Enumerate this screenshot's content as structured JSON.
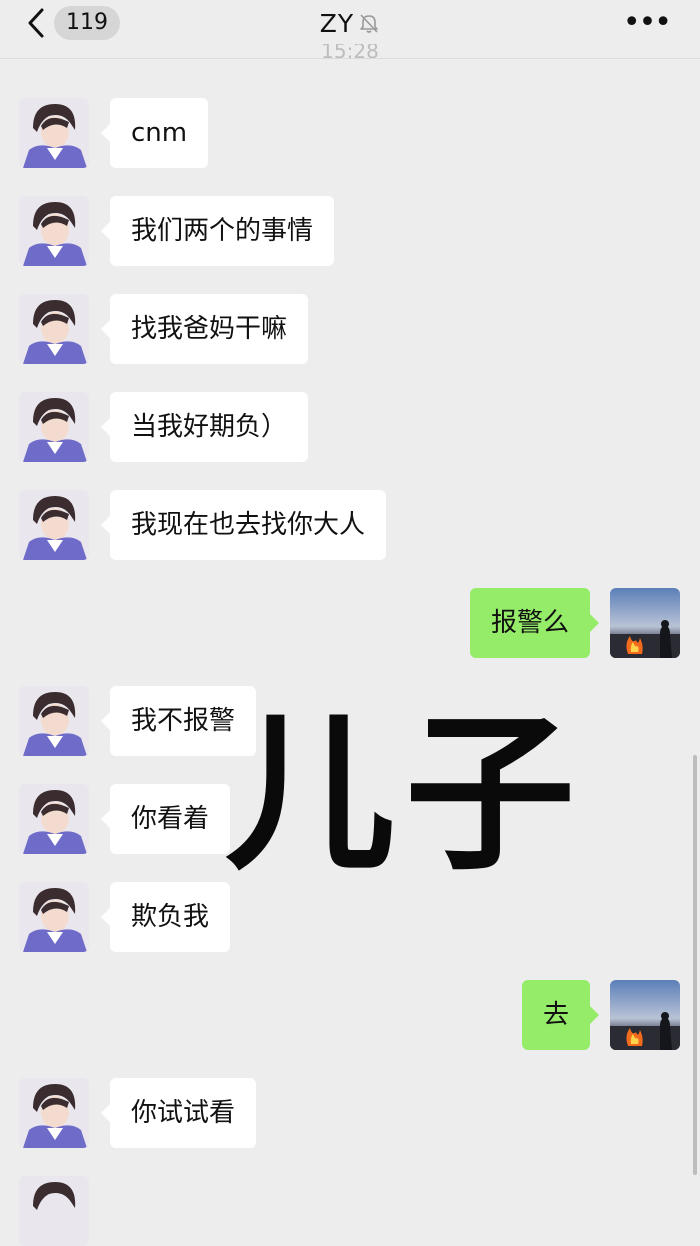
{
  "header": {
    "unread_count": "119",
    "title": "ZY",
    "timestamp_partial": "15:28"
  },
  "icons": {
    "back": "chevron-left-icon",
    "mute": "bell-slash-icon",
    "more": "more-dots-icon"
  },
  "overlay_text": "儿子",
  "messages": [
    {
      "side": "left",
      "text": "cnm"
    },
    {
      "side": "left",
      "text": "我们两个的事情"
    },
    {
      "side": "left",
      "text": "找我爸妈干嘛"
    },
    {
      "side": "left",
      "text": "当我好期负）"
    },
    {
      "side": "left",
      "text": "我现在也去找你大人"
    },
    {
      "side": "right",
      "text": "报警么"
    },
    {
      "side": "left",
      "text": "我不报警"
    },
    {
      "side": "left",
      "text": "你看着"
    },
    {
      "side": "left",
      "text": "欺负我"
    },
    {
      "side": "right",
      "text": "去"
    },
    {
      "side": "left",
      "text": "你试试看"
    }
  ],
  "colors": {
    "background": "#ededed",
    "incoming_bubble": "#ffffff",
    "outgoing_bubble": "#95ec69"
  }
}
